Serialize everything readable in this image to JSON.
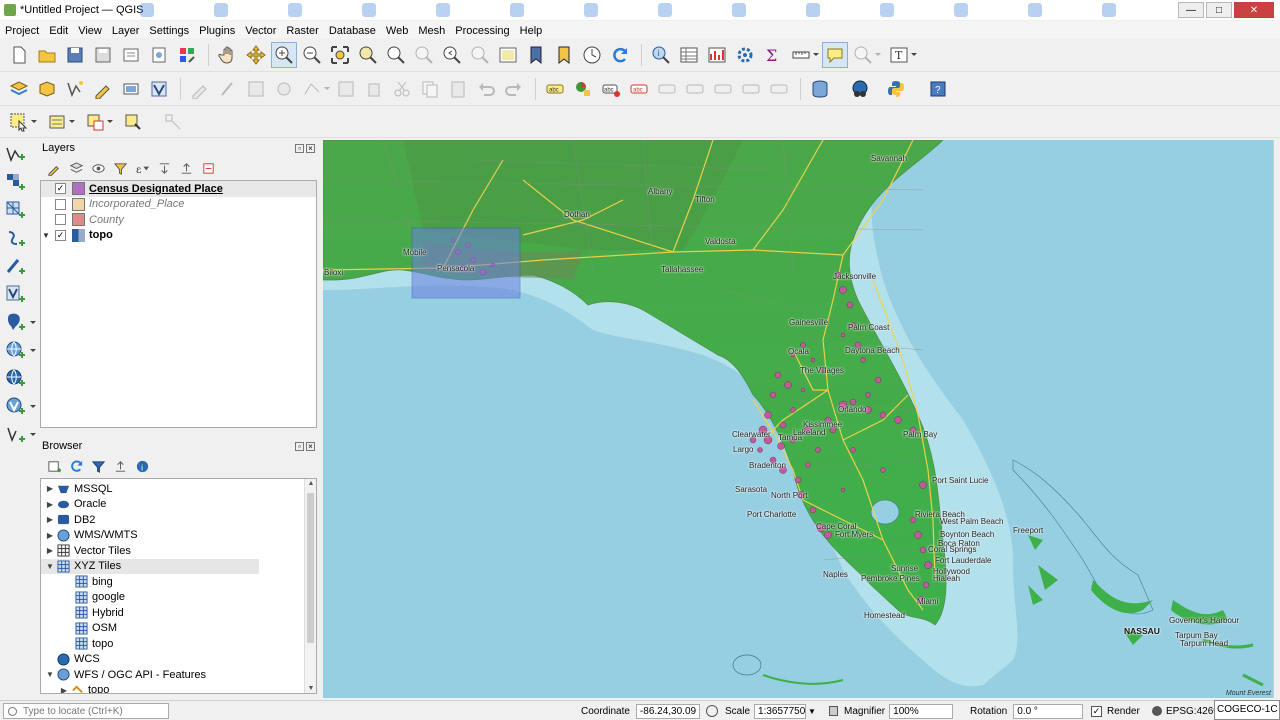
{
  "window": {
    "title": "*Untitled Project — QGIS",
    "min": "—",
    "max": "□",
    "close": "✕"
  },
  "menu": [
    "Project",
    "Edit",
    "View",
    "Layer",
    "Settings",
    "Plugins",
    "Vector",
    "Raster",
    "Database",
    "Web",
    "Mesh",
    "Processing",
    "Help"
  ],
  "layers_panel": {
    "title": "Layers",
    "items": [
      {
        "name": "Census Designated Place",
        "checked": "✓",
        "color": "#b06fbf"
      },
      {
        "name": "Incorporated_Place",
        "checked": "",
        "color": "#f2d5a8"
      },
      {
        "name": "County",
        "checked": "",
        "color": "#e08b8b"
      },
      {
        "name": "topo",
        "checked": "✓",
        "expand": "▼"
      }
    ]
  },
  "browser_panel": {
    "title": "Browser",
    "items": [
      {
        "name": "MSSQL",
        "expand": "▶",
        "icon": "mssql-icon"
      },
      {
        "name": "Oracle",
        "expand": "▶",
        "icon": "oracle-icon"
      },
      {
        "name": "DB2",
        "expand": "▶",
        "icon": "db2-icon"
      },
      {
        "name": "WMS/WMTS",
        "expand": "▶",
        "icon": "globe-icon"
      },
      {
        "name": "Vector Tiles",
        "expand": "▶",
        "icon": "grid-icon"
      },
      {
        "name": "XYZ Tiles",
        "expand": "▼",
        "icon": "grid-icon"
      },
      {
        "name": "bing",
        "expand": "",
        "icon": "tile-icon"
      },
      {
        "name": "google",
        "expand": "",
        "icon": "tile-icon"
      },
      {
        "name": "Hybrid",
        "expand": "",
        "icon": "tile-icon"
      },
      {
        "name": "OSM",
        "expand": "",
        "icon": "tile-icon"
      },
      {
        "name": "topo",
        "expand": "",
        "icon": "tile-icon"
      },
      {
        "name": "WCS",
        "expand": "",
        "icon": "globe-icon"
      },
      {
        "name": "WFS / OGC API - Features",
        "expand": "▼",
        "icon": "globe-icon"
      },
      {
        "name": "topo",
        "expand": "▶",
        "icon": "wfs-icon"
      }
    ]
  },
  "map": {
    "labels": [
      "Savannah",
      "Albany",
      "Tifton",
      "Dothan",
      "Valdosta",
      "Mobile",
      "Biloxi",
      "Pensacola",
      "Tallahassee",
      "Jacksonville",
      "Gainesville",
      "Palm Coast",
      "Ocala",
      "Daytona Beach",
      "Orlando",
      "The Villages",
      "Palm Bay",
      "Clearwater",
      "Tampa",
      "Lakeland",
      "Bradenton",
      "Sarasota",
      "Port Saint Lucie",
      "North Port",
      "Port Charlotte",
      "Cape Coral",
      "Fort Myers",
      "Riviera Beach",
      "West Palm Beach",
      "Boynton Beach",
      "Boca Raton",
      "Coral Springs",
      "Fort Lauderdale",
      "Hollywood",
      "Sunrise",
      "Pembroke Pines",
      "Hialeah",
      "Miami",
      "Homestead",
      "Freeport",
      "NASSAU",
      "Governor's Harbour",
      "Tarpum Bay",
      "Tarpum Head",
      "Kissimmee",
      "Largo",
      "Naples"
    ],
    "attribution": "Mount Everest"
  },
  "status": {
    "locator_placeholder": "Type to locate (Ctrl+K)",
    "coordinate_label": "Coordinate",
    "coordinate": "-86.24,30.09",
    "scale_label": "Scale",
    "scale": "1:3657750",
    "magnifier_label": "Magnifier",
    "magnifier": "100%",
    "rotation_label": "Rotation",
    "rotation": "0.0 °",
    "render_label": "Render",
    "render_checked": "✓",
    "crs": "EPSG:4269",
    "overlay": "COGECO-1C"
  }
}
